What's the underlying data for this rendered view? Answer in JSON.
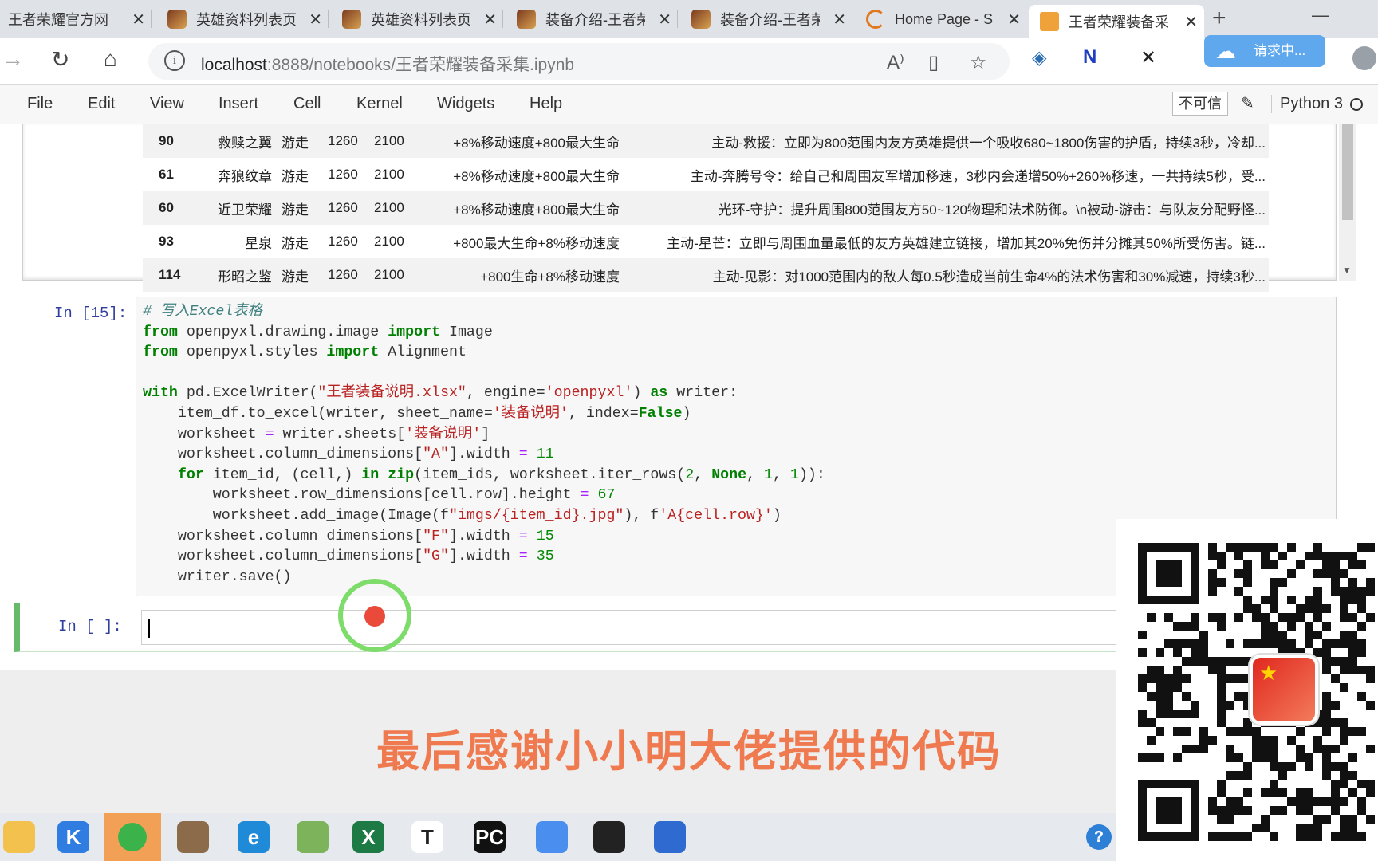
{
  "browser": {
    "tabs": [
      {
        "title": "王者荣耀官方网"
      },
      {
        "title": "英雄资料列表页"
      },
      {
        "title": "英雄资料列表页"
      },
      {
        "title": "装备介绍-王者荣"
      },
      {
        "title": "装备介绍-王者荣"
      },
      {
        "title": "Home Page - S"
      },
      {
        "title": "王者荣耀装备采"
      }
    ],
    "close_glyph": "✕",
    "new_tab": "+",
    "minimize": "—",
    "url_host": "localhost",
    "url_path": ":8888/notebooks/王者荣耀装备采集.ipynb",
    "cloud_status": "请求中..."
  },
  "jupyter": {
    "menu": [
      "File",
      "Edit",
      "View",
      "Insert",
      "Cell",
      "Kernel",
      "Widgets",
      "Help"
    ],
    "trust_label": "不可信",
    "kernel_name": "Python 3"
  },
  "output_table": {
    "rows": [
      {
        "id": "90",
        "name": "救赎之翼",
        "type": "游走",
        "price": "1260",
        "total": "2100",
        "attr": "+8%移动速度+800最大生命",
        "desc": "主动-救援：立即为800范围内友方英雄提供一个吸收680~1800伤害的护盾，持续3秒，冷却..."
      },
      {
        "id": "61",
        "name": "奔狼纹章",
        "type": "游走",
        "price": "1260",
        "total": "2100",
        "attr": "+8%移动速度+800最大生命",
        "desc": "主动-奔腾号令：给自己和周围友军增加移速，3秒内会递增50%+260%移速，一共持续5秒，受..."
      },
      {
        "id": "60",
        "name": "近卫荣耀",
        "type": "游走",
        "price": "1260",
        "total": "2100",
        "attr": "+8%移动速度+800最大生命",
        "desc": "光环-守护：提升周围800范围友方50~120物理和法术防御。\\n被动-游击：与队友分配野怪..."
      },
      {
        "id": "93",
        "name": "星泉",
        "type": "游走",
        "price": "1260",
        "total": "2100",
        "attr": "+800最大生命+8%移动速度",
        "desc": "主动-星芒：立即与周围血量最低的友方英雄建立链接，增加其20%免伤并分摊其50%所受伤害。链..."
      },
      {
        "id": "114",
        "name": "形昭之鉴",
        "type": "游走",
        "price": "1260",
        "total": "2100",
        "attr": "+800生命+8%移动速度",
        "desc": "主动-见影：对1000范围内的敌人每0.5秒造成当前生命4%的法术伤害和30%减速，持续3秒..."
      }
    ]
  },
  "cells": {
    "executed_prompt": "In  [15]:",
    "empty_prompt": "In  [ ]:",
    "code_lines": [
      [
        {
          "t": "# 写入Excel表格",
          "c": "cm"
        }
      ],
      [
        {
          "t": "from",
          "c": "kw"
        },
        {
          "t": " openpyxl.drawing.image "
        },
        {
          "t": "import",
          "c": "kw"
        },
        {
          "t": " Image"
        }
      ],
      [
        {
          "t": "from",
          "c": "kw"
        },
        {
          "t": " openpyxl.styles "
        },
        {
          "t": "import",
          "c": "kw"
        },
        {
          "t": " Alignment"
        }
      ],
      [
        {
          "t": ""
        }
      ],
      [
        {
          "t": "with",
          "c": "kw"
        },
        {
          "t": " pd.ExcelWriter("
        },
        {
          "t": "\"王者装备说明.xlsx\"",
          "c": "st"
        },
        {
          "t": ", engine="
        },
        {
          "t": "'openpyxl'",
          "c": "st"
        },
        {
          "t": ") "
        },
        {
          "t": "as",
          "c": "kw"
        },
        {
          "t": " writer:"
        }
      ],
      [
        {
          "t": "    item_df.to_excel(writer, sheet_name="
        },
        {
          "t": "'装备说明'",
          "c": "st"
        },
        {
          "t": ", index="
        },
        {
          "t": "False",
          "c": "kw"
        },
        {
          "t": ")"
        }
      ],
      [
        {
          "t": "    worksheet "
        },
        {
          "t": "=",
          "c": "op"
        },
        {
          "t": " writer.sheets["
        },
        {
          "t": "'装备说明'",
          "c": "st"
        },
        {
          "t": "]"
        }
      ],
      [
        {
          "t": "    worksheet.column_dimensions["
        },
        {
          "t": "\"A\"",
          "c": "st"
        },
        {
          "t": "].width "
        },
        {
          "t": "=",
          "c": "op"
        },
        {
          "t": " "
        },
        {
          "t": "11",
          "c": "nu"
        }
      ],
      [
        {
          "t": "    "
        },
        {
          "t": "for",
          "c": "kw"
        },
        {
          "t": " item_id, (cell,) "
        },
        {
          "t": "in",
          "c": "kw"
        },
        {
          "t": " "
        },
        {
          "t": "zip",
          "c": "kw"
        },
        {
          "t": "(item_ids, worksheet.iter_rows("
        },
        {
          "t": "2",
          "c": "nu"
        },
        {
          "t": ", "
        },
        {
          "t": "None",
          "c": "kw"
        },
        {
          "t": ", "
        },
        {
          "t": "1",
          "c": "nu"
        },
        {
          "t": ", "
        },
        {
          "t": "1",
          "c": "nu"
        },
        {
          "t": ")):"
        }
      ],
      [
        {
          "t": "        worksheet.row_dimensions[cell.row].height "
        },
        {
          "t": "=",
          "c": "op"
        },
        {
          "t": " "
        },
        {
          "t": "67",
          "c": "nu"
        }
      ],
      [
        {
          "t": "        worksheet.add_image(Image(f"
        },
        {
          "t": "\"imgs/{item_id}.jpg\"",
          "c": "st"
        },
        {
          "t": "), f"
        },
        {
          "t": "'A{cell.row}'",
          "c": "st"
        },
        {
          "t": ")"
        }
      ],
      [
        {
          "t": "    worksheet.column_dimensions["
        },
        {
          "t": "\"F\"",
          "c": "st"
        },
        {
          "t": "].width "
        },
        {
          "t": "=",
          "c": "op"
        },
        {
          "t": " "
        },
        {
          "t": "15",
          "c": "nu"
        }
      ],
      [
        {
          "t": "    worksheet.column_dimensions["
        },
        {
          "t": "\"G\"",
          "c": "st"
        },
        {
          "t": "].width "
        },
        {
          "t": "=",
          "c": "op"
        },
        {
          "t": " "
        },
        {
          "t": "35",
          "c": "nu"
        }
      ],
      [
        {
          "t": "    writer.save()"
        }
      ]
    ]
  },
  "caption": "最后感谢小小明大佬提供的代码",
  "taskbar": {
    "items": [
      {
        "name": "file-explorer-icon",
        "color": "#f2c14e",
        "glyph": ""
      },
      {
        "name": "kugou-icon",
        "color": "#2f7de1",
        "glyph": "K"
      },
      {
        "name": "wechat-icon",
        "color": "#f2a055",
        "glyph": "",
        "active": true
      },
      {
        "name": "game-icon",
        "color": "#8b6b4a",
        "glyph": ""
      },
      {
        "name": "edge-icon",
        "color": "#1f8ad8",
        "glyph": "e"
      },
      {
        "name": "notepad-icon",
        "color": "#7cb35b",
        "glyph": ""
      },
      {
        "name": "excel-icon",
        "color": "#1d7a45",
        "glyph": "X"
      },
      {
        "name": "typora-icon",
        "color": "#ffffff",
        "glyph": "T"
      },
      {
        "name": "pycharm-icon",
        "color": "#111111",
        "glyph": "PC"
      },
      {
        "name": "baidu-netdisk-icon",
        "color": "#4a8ff0",
        "glyph": ""
      },
      {
        "name": "terminal-icon",
        "color": "#222222",
        "glyph": ""
      },
      {
        "name": "video-recorder-icon",
        "color": "#2f6ad0",
        "glyph": ""
      }
    ]
  },
  "colors": {
    "accent_caption": "#f07a50",
    "selected_cell_bar": "#66bb6a",
    "prompt": "#303f9f"
  }
}
